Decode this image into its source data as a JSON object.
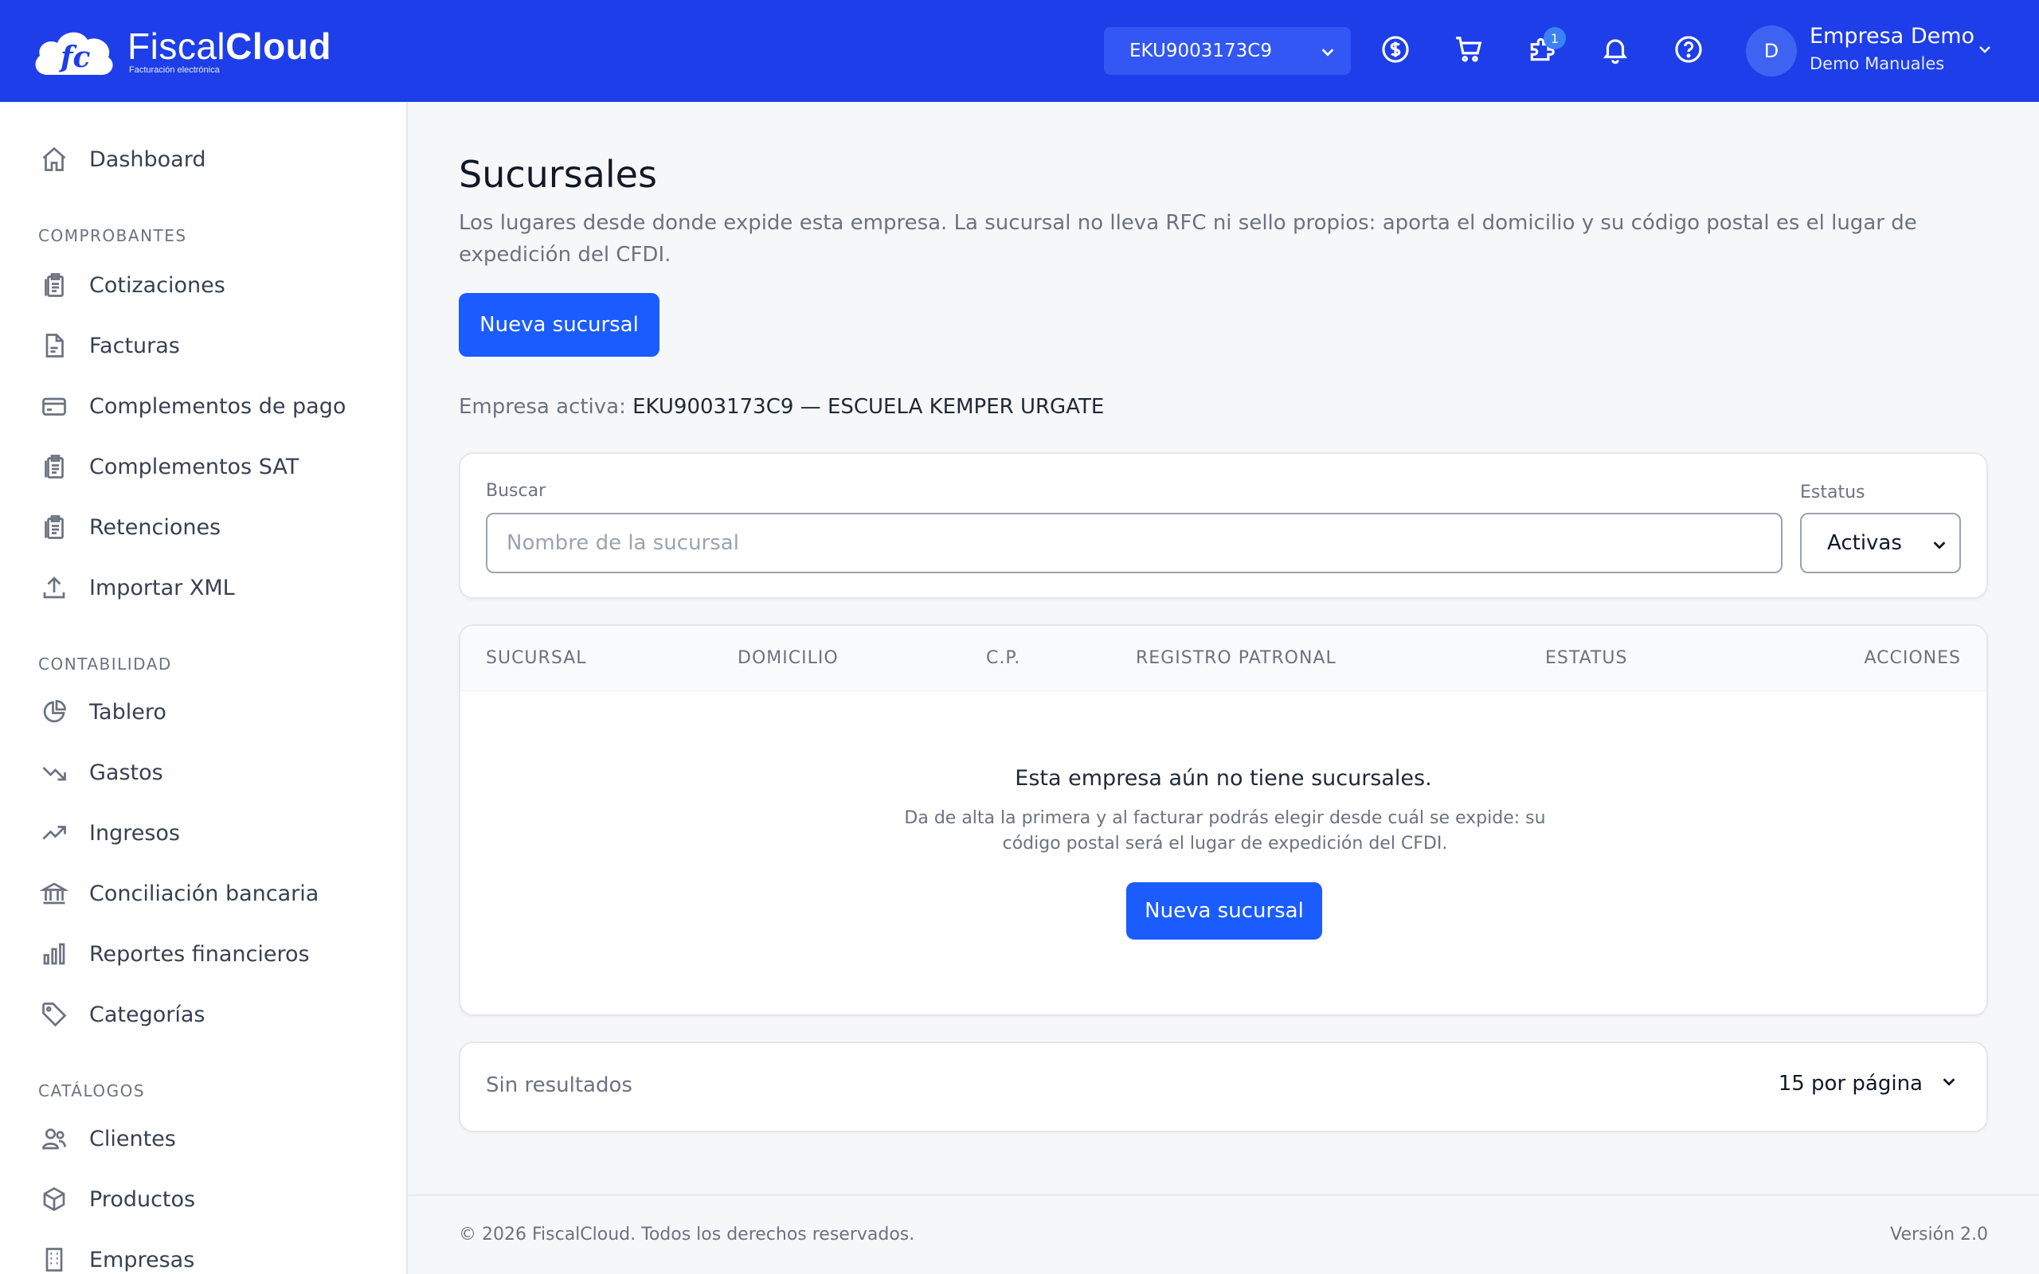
{
  "header": {
    "logo_light": "Fiscal",
    "logo_bold": "Cloud",
    "logo_sub": "Facturación electrónica",
    "rfc_selected": "EKU9003173C9",
    "notifications_badge": "1",
    "user": {
      "initial": "D",
      "name": "Empresa Demo",
      "sub": "Demo Manuales"
    },
    "icons": [
      "dollar-icon",
      "cart-icon",
      "puzzle-icon",
      "bell-icon",
      "help-icon",
      "chevron-down-icon"
    ]
  },
  "sidebar": {
    "dashboard": "Dashboard",
    "sections": [
      {
        "title": "COMPROBANTES",
        "items": [
          "Cotizaciones",
          "Facturas",
          "Complementos de pago",
          "Complementos SAT",
          "Retenciones",
          "Importar XML"
        ]
      },
      {
        "title": "CONTABILIDAD",
        "items": [
          "Tablero",
          "Gastos",
          "Ingresos",
          "Conciliación bancaria",
          "Reportes financieros",
          "Categorías"
        ]
      },
      {
        "title": "CATÁLOGOS",
        "items": [
          "Clientes",
          "Productos",
          "Empresas"
        ]
      }
    ]
  },
  "main": {
    "title": "Sucursales",
    "description": "Los lugares desde donde expide esta empresa. La sucursal no lleva RFC ni sello propios: aporta el domicilio y su código postal es el lugar de expedición del CFDI.",
    "new_button": "Nueva sucursal",
    "active_company_label": "Empresa activa:",
    "active_company_value": "EKU9003173C9 — ESCUELA KEMPER URGATE",
    "filters": {
      "search_label": "Buscar",
      "search_placeholder": "Nombre de la sucursal",
      "search_value": "",
      "status_label": "Estatus",
      "status_value": "Activas"
    },
    "table": {
      "columns": [
        "SUCURSAL",
        "DOMICILIO",
        "C.P.",
        "REGISTRO PATRONAL",
        "ESTATUS",
        "ACCIONES"
      ],
      "rows": [],
      "empty_title": "Esta empresa aún no tiene sucursales.",
      "empty_desc": "Da de alta la primera y al facturar podrás elegir desde cuál se expide: su código postal será el lugar de expedición del CFDI.",
      "empty_button": "Nueva sucursal"
    },
    "pager": {
      "results_text": "Sin resultados",
      "per_page": "15 por página"
    }
  },
  "footer": {
    "copyright": "© 2026 FiscalCloud. Todos los derechos reservados.",
    "version": "Versión 2.0"
  },
  "colors": {
    "brand": "#1d3ee8",
    "primary_button": "#1a5cff",
    "sidebar_bg": "#ffffff",
    "page_bg": "#f6f7f9"
  }
}
